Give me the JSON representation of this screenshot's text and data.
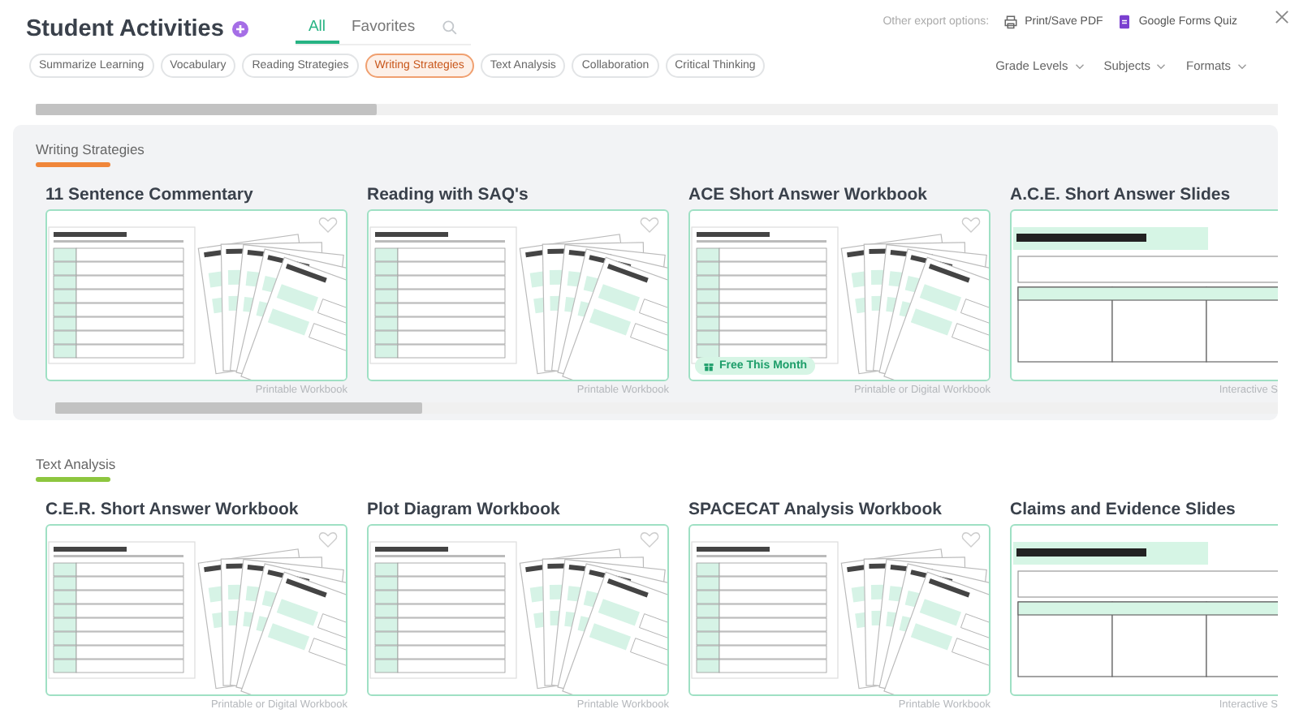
{
  "header": {
    "title": "Student Activities",
    "tabs": [
      {
        "label": "All",
        "selected": true
      },
      {
        "label": "Favorites",
        "selected": false
      }
    ],
    "export_label": "Other export options:",
    "export_options": [
      {
        "kind": "print",
        "label": "Print/Save PDF"
      },
      {
        "kind": "forms",
        "label": "Google Forms Quiz"
      }
    ]
  },
  "categories": [
    {
      "label": "Summarize Learning",
      "selected": false
    },
    {
      "label": "Vocabulary",
      "selected": false
    },
    {
      "label": "Reading Strategies",
      "selected": false
    },
    {
      "label": "Writing Strategies",
      "selected": true
    },
    {
      "label": "Text Analysis",
      "selected": false
    },
    {
      "label": "Collaboration",
      "selected": false
    },
    {
      "label": "Critical Thinking",
      "selected": false
    }
  ],
  "filters": [
    "Grade Levels",
    "Subjects",
    "Formats"
  ],
  "sections": [
    {
      "title": "Writing Strategies",
      "color": "#f0863a",
      "highlighted": true,
      "activities": [
        {
          "title": "11 Sentence Commentary",
          "format": "Printable Workbook",
          "kind": "workbook"
        },
        {
          "title": "Reading with SAQ's",
          "format": "Printable Workbook",
          "kind": "workbook"
        },
        {
          "title": "ACE Short Answer Workbook",
          "format": "Printable or Digital Workbook",
          "kind": "workbook",
          "badge": "Free This Month"
        },
        {
          "title": "A.C.E. Short Answer Slides",
          "format": "Interactive S",
          "kind": "slides"
        }
      ]
    },
    {
      "title": "Text Analysis",
      "color": "#8dc63f",
      "highlighted": false,
      "activities": [
        {
          "title": "C.E.R. Short Answer Workbook",
          "format": "Printable or Digital Workbook",
          "kind": "workbook"
        },
        {
          "title": "Plot Diagram Workbook",
          "format": "Printable Workbook",
          "kind": "workbook"
        },
        {
          "title": "SPACECAT Analysis Workbook",
          "format": "Printable Workbook",
          "kind": "workbook"
        },
        {
          "title": "Claims and Evidence Slides",
          "format": "Interactive S",
          "kind": "slides"
        }
      ]
    }
  ]
}
